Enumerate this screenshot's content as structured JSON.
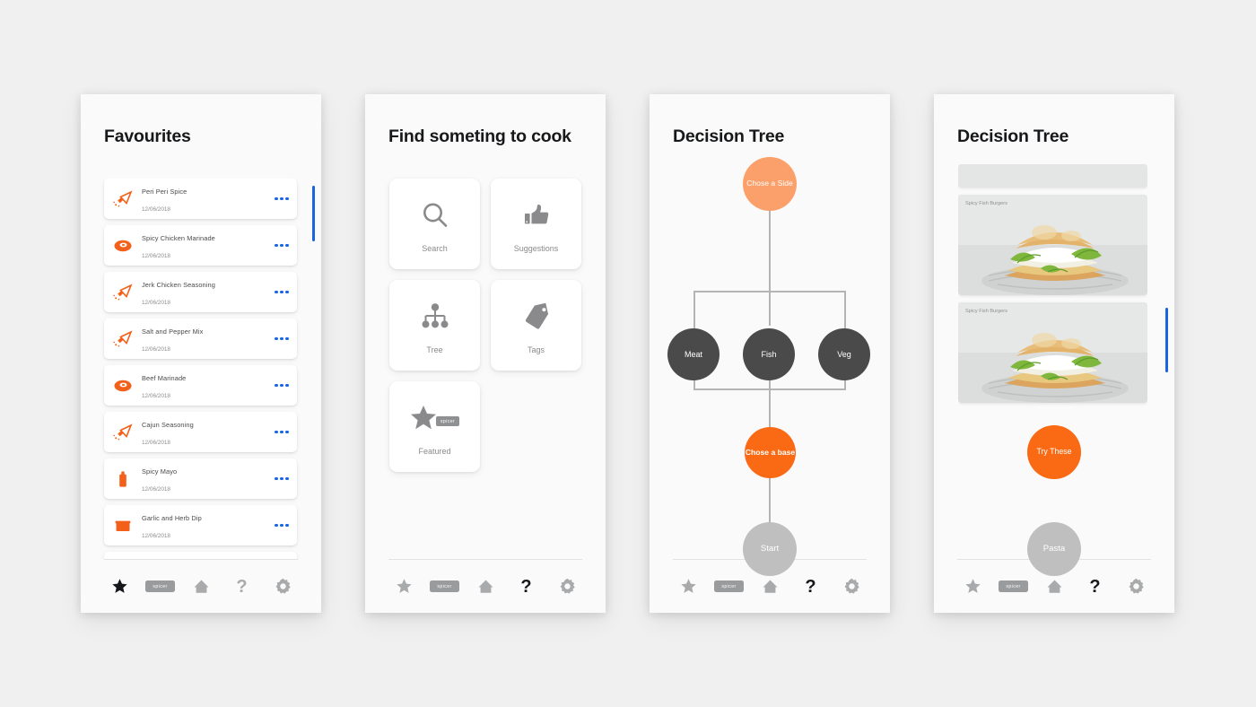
{
  "canvas": {
    "background": "#f0f0f0",
    "accent_orange": "#fa6a14",
    "accent_blue": "#1766e0"
  },
  "screen1": {
    "title": "Favourites",
    "items": [
      {
        "name": "Peri Peri Spice",
        "date": "12/06/2018",
        "icon": "spice-grinder-icon"
      },
      {
        "name": "Spicy Chicken Marinade",
        "date": "12/06/2018",
        "icon": "meat-cut-icon"
      },
      {
        "name": "Jerk Chicken Seasoning",
        "date": "12/06/2018",
        "icon": "spice-grinder-icon"
      },
      {
        "name": "Salt and Pepper Mix",
        "date": "12/06/2018",
        "icon": "spice-grinder-icon"
      },
      {
        "name": "Beef Marinade",
        "date": "12/06/2018",
        "icon": "meat-cut-icon"
      },
      {
        "name": "Cajun Seasoning",
        "date": "12/06/2018",
        "icon": "spice-grinder-icon"
      },
      {
        "name": "Spicy Mayo",
        "date": "12/06/2018",
        "icon": "sauce-bottle-icon"
      },
      {
        "name": "Garlic and Herb Dip",
        "date": "12/06/2018",
        "icon": "dip-tub-icon"
      }
    ],
    "more_label": "more-options"
  },
  "screen2": {
    "title": "Find someting to cook",
    "tiles": [
      {
        "label": "Search",
        "icon": "search-icon"
      },
      {
        "label": "Suggestions",
        "icon": "thumbs-up-icon"
      },
      {
        "label": "Tree",
        "icon": "tree-hierarchy-icon"
      },
      {
        "label": "Tags",
        "icon": "tag-icon"
      },
      {
        "label": "Featured",
        "icon": "star-icon",
        "badge": "spicer"
      }
    ]
  },
  "screen3": {
    "title": "Decision Tree",
    "nodes": [
      {
        "id": "side",
        "label": "Chose a Side",
        "color": "#fba06a",
        "state": "pending"
      },
      {
        "id": "meat",
        "label": "Meat",
        "color": "#4a4a4a",
        "state": "option"
      },
      {
        "id": "fish",
        "label": "Fish",
        "color": "#4a4a4a",
        "state": "option"
      },
      {
        "id": "veg",
        "label": "Veg",
        "color": "#4a4a4a",
        "state": "option"
      },
      {
        "id": "base",
        "label": "Chose a base",
        "color": "#fa6a14",
        "state": "current"
      },
      {
        "id": "start",
        "label": "Start",
        "color": "#bfbfbf",
        "state": "done"
      }
    ]
  },
  "screen4": {
    "title": "Decision Tree",
    "photos": [
      {
        "label": ""
      },
      {
        "label": "Spicy Fish Burgers"
      },
      {
        "label": "Spicy Fish Burgers"
      }
    ],
    "nodes": [
      {
        "id": "try",
        "label": "Try These",
        "color": "#fa6a14",
        "state": "current"
      },
      {
        "id": "pasta",
        "label": "Pasta",
        "color": "#bfbfbf",
        "state": "done"
      }
    ]
  },
  "nav": {
    "items": [
      {
        "id": "favourites",
        "icon": "star-icon",
        "label": ""
      },
      {
        "id": "spicer",
        "icon": "spicer-badge-icon",
        "label": "spicer"
      },
      {
        "id": "home",
        "icon": "home-icon",
        "label": ""
      },
      {
        "id": "help",
        "icon": "question-mark-icon",
        "label": "?"
      },
      {
        "id": "settings",
        "icon": "gear-icon",
        "label": ""
      }
    ],
    "active": {
      "screen1": "favourites",
      "screen2": "help",
      "screen3": "help",
      "screen4": "help"
    }
  }
}
